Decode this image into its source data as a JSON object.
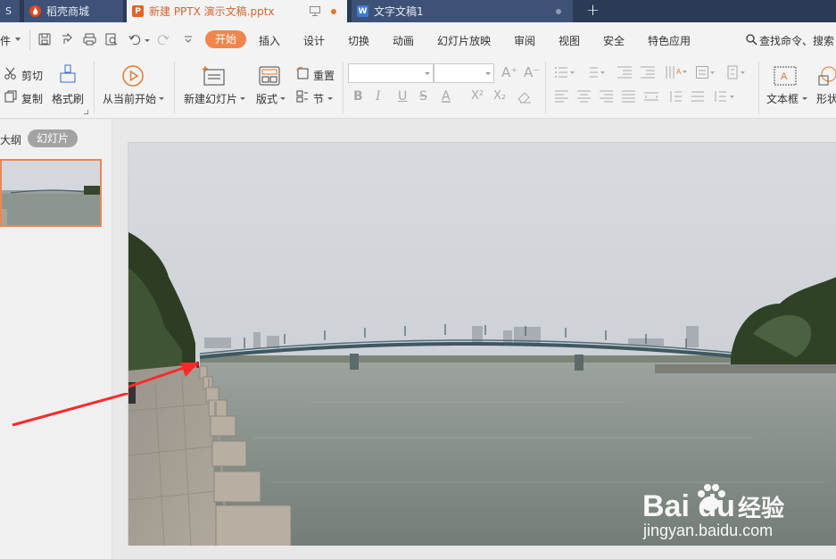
{
  "tabs": {
    "first_label": "S",
    "daoke_label": "稻壳商城",
    "ppt_label": "新建 PPTX 演示文稿.pptx",
    "doc_label": "文字文稿1",
    "ppt_icon": "P",
    "doc_icon": "W"
  },
  "menu": {
    "file_fragment": "件",
    "items": [
      "开始",
      "插入",
      "设计",
      "切换",
      "动画",
      "幻灯片放映",
      "审阅",
      "视图",
      "安全",
      "特色应用"
    ],
    "search": "查找命令、搜索"
  },
  "ribbon": {
    "cut": "剪切",
    "copy": "复制",
    "format_painter": "格式刷",
    "play_from_current": "从当前开始",
    "new_slide": "新建幻灯片",
    "layout": "版式",
    "reset": "重置",
    "section": "节",
    "textbox": "文本框",
    "shape_fragment": "形状"
  },
  "left_panel": {
    "outline_tab": "大纲",
    "slides_tab": "幻灯片"
  },
  "watermark": {
    "brand": "Bai  du",
    "cn": "经验",
    "url": "jingyan.baidu.com"
  },
  "colors": {
    "accent": "#f0864d",
    "tabbar": "#2b3a55",
    "ribbon_bg": "#f3f3f3",
    "arrow": "#ff2a2a"
  }
}
